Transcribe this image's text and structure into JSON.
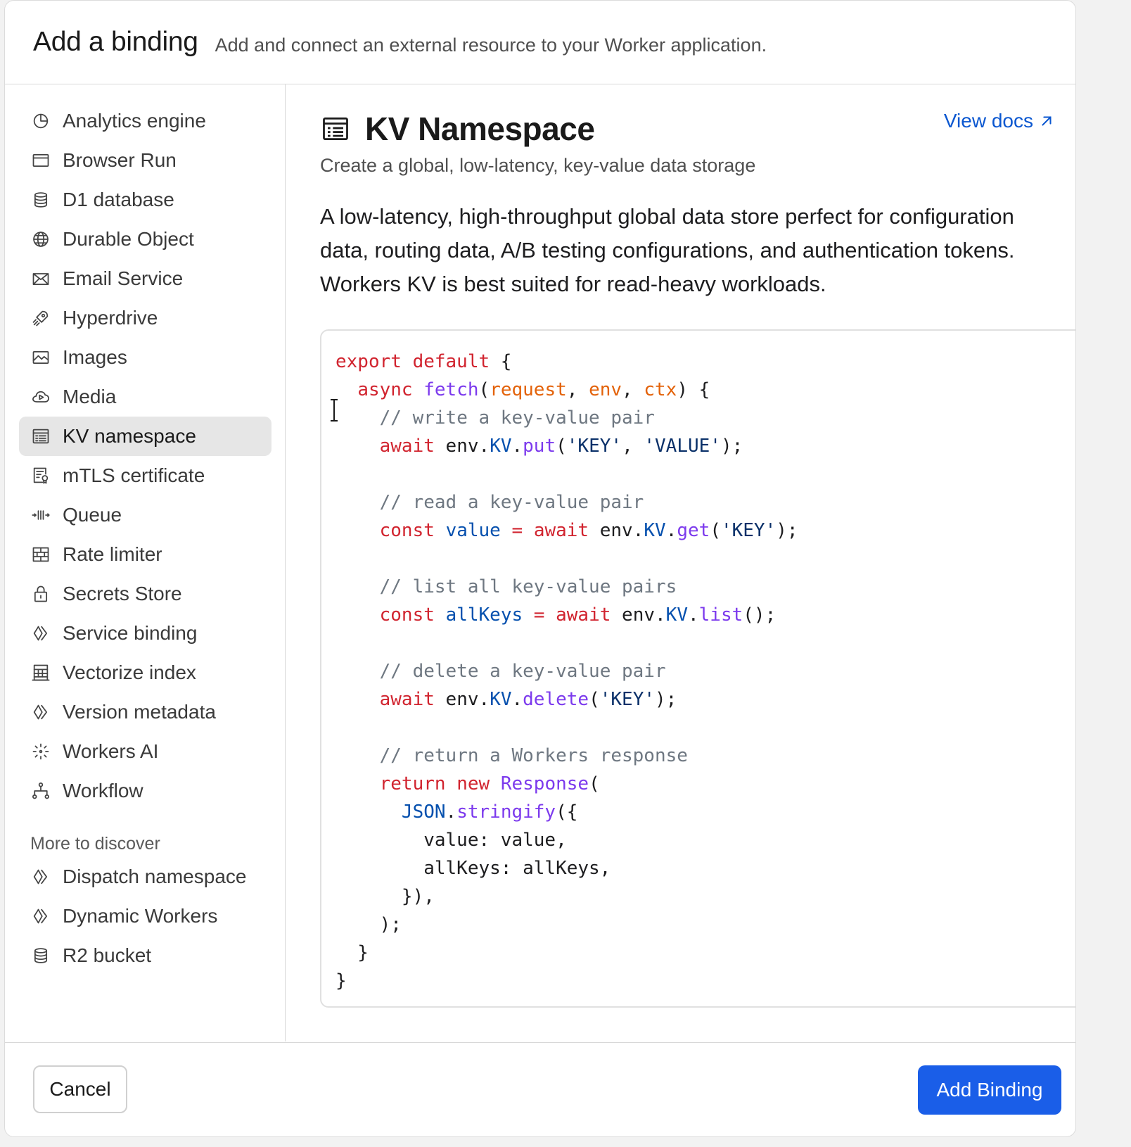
{
  "header": {
    "title": "Add a binding",
    "subtitle": "Add and connect an external resource to your Worker application."
  },
  "sidebar": {
    "items": [
      {
        "label": "Analytics engine",
        "icon": "analytics-icon",
        "active": false
      },
      {
        "label": "Browser Run",
        "icon": "browser-icon",
        "active": false
      },
      {
        "label": "D1 database",
        "icon": "database-icon",
        "active": false
      },
      {
        "label": "Durable Object",
        "icon": "globe-icon",
        "active": false
      },
      {
        "label": "Email Service",
        "icon": "mail-icon",
        "active": false
      },
      {
        "label": "Hyperdrive",
        "icon": "rocket-icon",
        "active": false
      },
      {
        "label": "Images",
        "icon": "image-icon",
        "active": false
      },
      {
        "label": "Media",
        "icon": "cloud-play-icon",
        "active": false
      },
      {
        "label": "KV namespace",
        "icon": "list-icon",
        "active": true
      },
      {
        "label": "mTLS certificate",
        "icon": "certificate-icon",
        "active": false
      },
      {
        "label": "Queue",
        "icon": "queue-icon",
        "active": false
      },
      {
        "label": "Rate limiter",
        "icon": "brick-wall-icon",
        "active": false
      },
      {
        "label": "Secrets Store",
        "icon": "lock-icon",
        "active": false
      },
      {
        "label": "Service binding",
        "icon": "workers-icon",
        "active": false
      },
      {
        "label": "Vectorize index",
        "icon": "vectorize-icon",
        "active": false
      },
      {
        "label": "Version metadata",
        "icon": "workers-icon",
        "active": false
      },
      {
        "label": "Workers AI",
        "icon": "sparkle-icon",
        "active": false
      },
      {
        "label": "Workflow",
        "icon": "workflow-icon",
        "active": false
      }
    ],
    "discover_heading": "More to discover",
    "discover_items": [
      {
        "label": "Dispatch namespace",
        "icon": "workers-icon"
      },
      {
        "label": "Dynamic Workers",
        "icon": "workers-icon"
      },
      {
        "label": "R2 bucket",
        "icon": "database-icon"
      }
    ]
  },
  "main": {
    "title": "KV Namespace",
    "title_icon": "list-icon",
    "view_docs": "View docs",
    "subtitle": "Create a global, low-latency, key-value data storage",
    "description": "A low-latency, high-throughput global data store perfect for configuration data, routing data, A/B testing configurations, and authentication tokens. Workers KV is best suited for read-heavy workloads.",
    "code_lines": [
      [
        [
          "kw",
          "export default"
        ],
        [
          "plain",
          " {"
        ]
      ],
      [
        [
          "plain",
          "  "
        ],
        [
          "kw",
          "async"
        ],
        [
          "plain",
          " "
        ],
        [
          "fn",
          "fetch"
        ],
        [
          "plain",
          "("
        ],
        [
          "param",
          "request"
        ],
        [
          "plain",
          ", "
        ],
        [
          "param",
          "env"
        ],
        [
          "plain",
          ", "
        ],
        [
          "param",
          "ctx"
        ],
        [
          "plain",
          ") {"
        ]
      ],
      [
        [
          "plain",
          "    "
        ],
        [
          "com",
          "// write a key-value pair"
        ]
      ],
      [
        [
          "plain",
          "    "
        ],
        [
          "kw",
          "await"
        ],
        [
          "plain",
          " env."
        ],
        [
          "var",
          "KV"
        ],
        [
          "plain",
          "."
        ],
        [
          "fn",
          "put"
        ],
        [
          "plain",
          "("
        ],
        [
          "str",
          "'KEY'"
        ],
        [
          "plain",
          ", "
        ],
        [
          "str",
          "'VALUE'"
        ],
        [
          "plain",
          ");"
        ]
      ],
      [],
      [
        [
          "plain",
          "    "
        ],
        [
          "com",
          "// read a key-value pair"
        ]
      ],
      [
        [
          "plain",
          "    "
        ],
        [
          "kw",
          "const"
        ],
        [
          "plain",
          " "
        ],
        [
          "var",
          "value"
        ],
        [
          "plain",
          " "
        ],
        [
          "kw",
          "="
        ],
        [
          "plain",
          " "
        ],
        [
          "kw",
          "await"
        ],
        [
          "plain",
          " env."
        ],
        [
          "var",
          "KV"
        ],
        [
          "plain",
          "."
        ],
        [
          "fn",
          "get"
        ],
        [
          "plain",
          "("
        ],
        [
          "str",
          "'KEY'"
        ],
        [
          "plain",
          ");"
        ]
      ],
      [],
      [
        [
          "plain",
          "    "
        ],
        [
          "com",
          "// list all key-value pairs"
        ]
      ],
      [
        [
          "plain",
          "    "
        ],
        [
          "kw",
          "const"
        ],
        [
          "plain",
          " "
        ],
        [
          "var",
          "allKeys"
        ],
        [
          "plain",
          " "
        ],
        [
          "kw",
          "="
        ],
        [
          "plain",
          " "
        ],
        [
          "kw",
          "await"
        ],
        [
          "plain",
          " env."
        ],
        [
          "var",
          "KV"
        ],
        [
          "plain",
          "."
        ],
        [
          "fn",
          "list"
        ],
        [
          "plain",
          "();"
        ]
      ],
      [],
      [
        [
          "plain",
          "    "
        ],
        [
          "com",
          "// delete a key-value pair"
        ]
      ],
      [
        [
          "plain",
          "    "
        ],
        [
          "kw",
          "await"
        ],
        [
          "plain",
          " env."
        ],
        [
          "var",
          "KV"
        ],
        [
          "plain",
          "."
        ],
        [
          "fn",
          "delete"
        ],
        [
          "plain",
          "("
        ],
        [
          "str",
          "'KEY'"
        ],
        [
          "plain",
          ");"
        ]
      ],
      [],
      [
        [
          "plain",
          "    "
        ],
        [
          "com",
          "// return a Workers response"
        ]
      ],
      [
        [
          "plain",
          "    "
        ],
        [
          "kw",
          "return"
        ],
        [
          "plain",
          " "
        ],
        [
          "kw",
          "new"
        ],
        [
          "plain",
          " "
        ],
        [
          "fn",
          "Response"
        ],
        [
          "plain",
          "("
        ]
      ],
      [
        [
          "plain",
          "      "
        ],
        [
          "var",
          "JSON"
        ],
        [
          "plain",
          "."
        ],
        [
          "fn",
          "stringify"
        ],
        [
          "plain",
          "({"
        ]
      ],
      [
        [
          "plain",
          "        value: value,"
        ]
      ],
      [
        [
          "plain",
          "        allKeys: allKeys,"
        ]
      ],
      [
        [
          "plain",
          "      }),"
        ]
      ],
      [
        [
          "plain",
          "    );"
        ]
      ],
      [
        [
          "plain",
          "  }"
        ]
      ],
      [
        [
          "plain",
          "}"
        ]
      ]
    ]
  },
  "footer": {
    "cancel_label": "Cancel",
    "add_label": "Add Binding"
  },
  "colors": {
    "accent": "#1a5ee8",
    "link": "#0b57d0",
    "active_bg": "#e6e6e6"
  }
}
